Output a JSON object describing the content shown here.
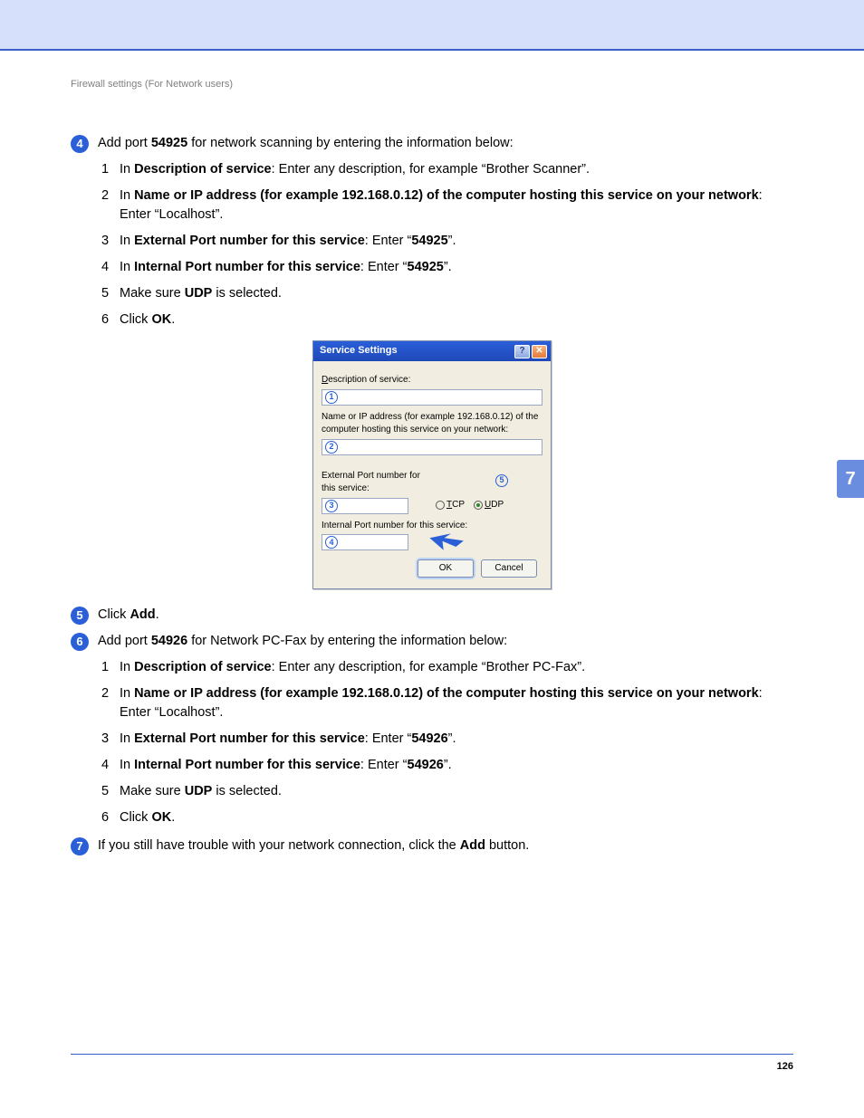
{
  "header": {
    "breadcrumb": "Firewall settings (For Network users)"
  },
  "sideTab": "7",
  "pageNumber": "126",
  "steps": {
    "s4": {
      "num": "4",
      "lead_a": "Add port ",
      "lead_port": "54925",
      "lead_b": " for network scanning by entering the information below:",
      "items": [
        {
          "n": "1",
          "pre": "In ",
          "bold": "Description of service",
          "post": ": Enter any description, for example “Brother Scanner”."
        },
        {
          "n": "2",
          "pre": "In ",
          "bold": "Name or IP address (for example 192.168.0.12) of the computer hosting this service on your network",
          "post": ": Enter “Localhost”."
        },
        {
          "n": "3",
          "pre": "In ",
          "bold": "External Port number for this service",
          "post": ": Enter “",
          "bold2": "54925",
          "post2": "”."
        },
        {
          "n": "4",
          "pre": "In ",
          "bold": "Internal Port number for this service",
          "post": ": Enter “",
          "bold2": "54925",
          "post2": "”."
        },
        {
          "n": "5",
          "pre": "Make sure ",
          "bold": "UDP",
          "post": " is selected."
        },
        {
          "n": "6",
          "pre": "Click ",
          "bold": "OK",
          "post": "."
        }
      ]
    },
    "s5": {
      "num": "5",
      "pre": "Click ",
      "bold": "Add",
      "post": "."
    },
    "s6": {
      "num": "6",
      "lead_a": "Add port ",
      "lead_port": "54926",
      "lead_b": " for Network PC-Fax by entering the information below:",
      "items": [
        {
          "n": "1",
          "pre": "In ",
          "bold": "Description of service",
          "post": ": Enter any description, for example “Brother PC-Fax”."
        },
        {
          "n": "2",
          "pre": "In ",
          "bold": "Name or IP address (for example 192.168.0.12) of the computer hosting this service on your network",
          "post": ": Enter “Localhost”."
        },
        {
          "n": "3",
          "pre": "In ",
          "bold": "External Port number for this service",
          "post": ": Enter “",
          "bold2": "54926",
          "post2": "”."
        },
        {
          "n": "4",
          "pre": "In ",
          "bold": "Internal Port number for this service",
          "post": ": Enter “",
          "bold2": "54926",
          "post2": "”."
        },
        {
          "n": "5",
          "pre": "Make sure ",
          "bold": "UDP",
          "post": " is selected."
        },
        {
          "n": "6",
          "pre": "Click ",
          "bold": "OK",
          "post": "."
        }
      ]
    },
    "s7": {
      "num": "7",
      "pre": "If you still have trouble with your network connection, click the ",
      "bold": "Add",
      "post": " button."
    }
  },
  "dialog": {
    "title": "Service Settings",
    "labels": {
      "desc": "Description of service:",
      "host": "Name or IP address (for example 192.168.0.12) of the computer hosting this service on your network:",
      "ext": "External Port number for this service:",
      "int": "Internal Port number for this service:"
    },
    "markers": {
      "m1": "1",
      "m2": "2",
      "m3": "3",
      "m4": "4",
      "m5": "5"
    },
    "radios": {
      "tcp": "TCP",
      "udp": "UDP"
    },
    "buttons": {
      "ok": "OK",
      "cancel": "Cancel"
    }
  }
}
